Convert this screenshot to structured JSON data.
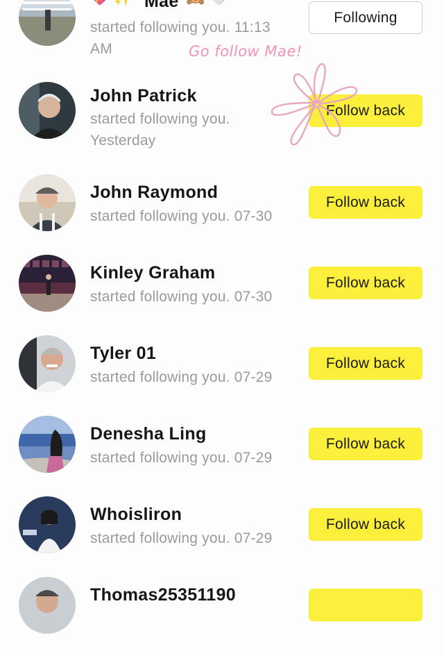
{
  "notifications": [
    {
      "name": "Mae",
      "message": "started following you. 11:13 AM",
      "action": "Following",
      "style": "outline"
    },
    {
      "name": "John Patrick",
      "message": "started following you. Yesterday",
      "action": "Follow back",
      "style": "yellow"
    },
    {
      "name": "John Raymond",
      "message": "started following you. 07-30",
      "action": "Follow back",
      "style": "yellow"
    },
    {
      "name": "Kinley Graham",
      "message": "started following you. 07-30",
      "action": "Follow back",
      "style": "yellow"
    },
    {
      "name": "Tyler 01",
      "message": "started following you. 07-29",
      "action": "Follow back",
      "style": "yellow"
    },
    {
      "name": "Denesha Ling",
      "message": "started following you. 07-29",
      "action": "Follow back",
      "style": "yellow"
    },
    {
      "name": "Whoisliron",
      "message": "started following you. 07-29",
      "action": "Follow back",
      "style": "yellow"
    },
    {
      "name": "Thomas25351190",
      "message": "",
      "action": "",
      "style": "yellow"
    }
  ],
  "overlay": {
    "handwritten_note": "Go follow Mae!"
  },
  "emoji": {
    "mae_prefix": "💖 ✨",
    "mae_suffix": "🙈 🤍"
  },
  "colors": {
    "follow_back_bg": "#fbef3c",
    "note_pink": "#ef93b6",
    "message_gray": "#9a9a9a"
  }
}
